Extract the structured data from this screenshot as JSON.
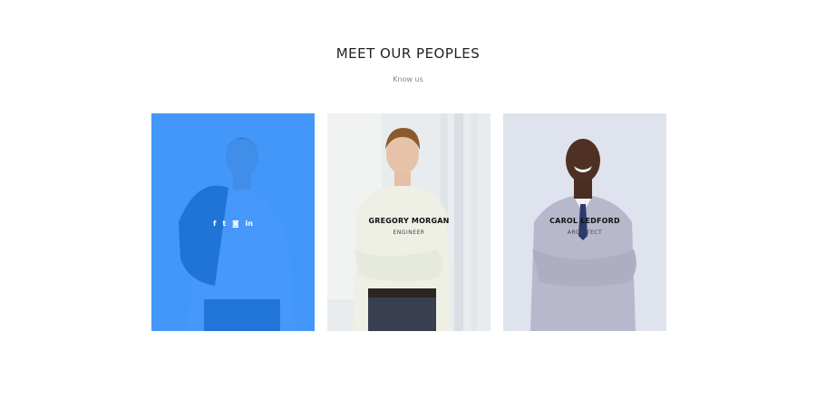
{
  "section": {
    "title": "MEET OUR PEOPLES",
    "subtitle": "Know us"
  },
  "team": [
    {
      "name": "",
      "role": "",
      "social_icons": [
        "facebook-icon",
        "twitter-icon",
        "instagram-icon",
        "linkedin-icon"
      ],
      "social_glyphs": [
        "f",
        "t",
        "◙",
        "in"
      ],
      "overlay_color": "#1e84fa"
    },
    {
      "name": "GREGORY MORGAN",
      "role": "ENGINEER"
    },
    {
      "name": "CAROL LEDFORD",
      "role": "ARCHITECT"
    }
  ]
}
